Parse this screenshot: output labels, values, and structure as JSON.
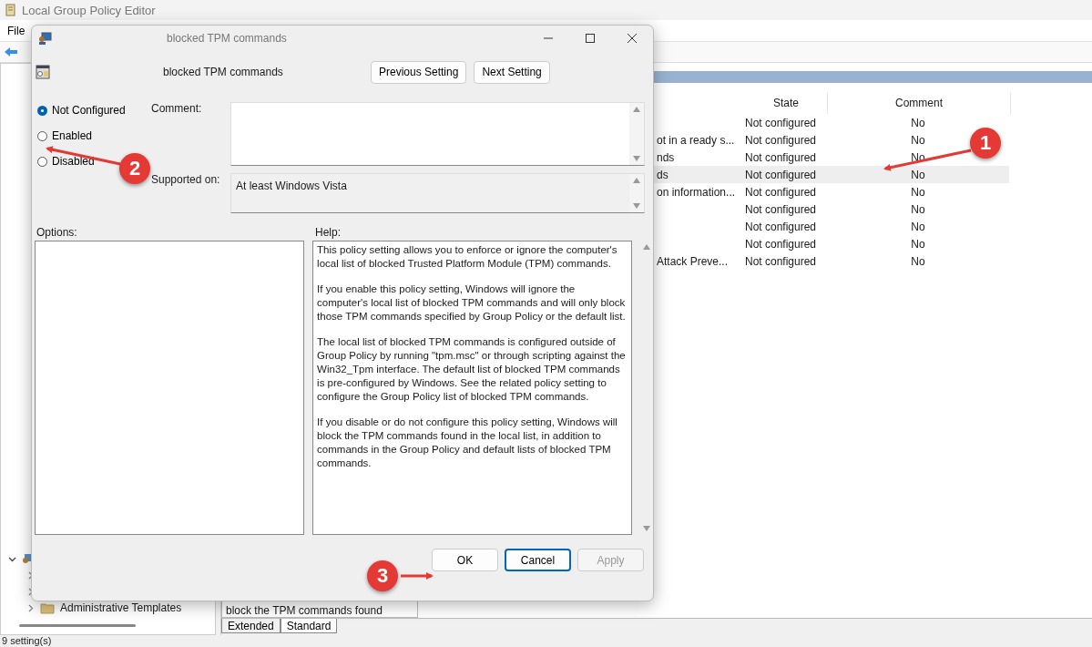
{
  "window": {
    "title": "Local Group Policy Editor",
    "menu": [
      "File"
    ]
  },
  "tree": {
    "items": [
      {
        "expanded": true
      },
      {
        "expanded": false
      },
      {
        "expanded": false
      },
      {
        "label": "Administrative Templates",
        "expanded": false
      }
    ]
  },
  "table": {
    "columns": [
      "State",
      "Comment"
    ],
    "rows": [
      {
        "state": "Not configured",
        "comment": "No",
        "selected": false
      },
      {
        "name": "ot in a ready s...",
        "state": "Not configured",
        "comment": "No",
        "selected": false
      },
      {
        "name": "nds",
        "state": "Not configured",
        "comment": "No",
        "selected": false
      },
      {
        "name": "ds",
        "state": "Not configured",
        "comment": "No",
        "selected": true
      },
      {
        "name": "on information...",
        "state": "Not configured",
        "comment": "No",
        "selected": false
      },
      {
        "state": "Not configured",
        "comment": "No",
        "selected": false
      },
      {
        "state": "Not configured",
        "comment": "No",
        "selected": false
      },
      {
        "state": "Not configured",
        "comment": "No",
        "selected": false
      },
      {
        "name": "Attack Preve...",
        "state": "Not configured",
        "comment": "No",
        "selected": false
      }
    ]
  },
  "description_pane": {
    "text": "block the TPM commands found"
  },
  "view_tabs": [
    {
      "label": "Extended",
      "selected": false
    },
    {
      "label": "Standard",
      "selected": true
    }
  ],
  "status_bar": "9 setting(s)",
  "dialog": {
    "title": "blocked TPM commands",
    "heading": "blocked TPM commands",
    "nav_buttons": [
      "Previous Setting",
      "Next Setting"
    ],
    "options": [
      {
        "label": "Not Configured",
        "selected": true
      },
      {
        "label": "Enabled",
        "selected": false
      },
      {
        "label": "Disabled",
        "selected": false
      }
    ],
    "comment_label": "Comment:",
    "supported_label": "Supported on:",
    "supported_value": "At least Windows Vista",
    "options_label": "Options:",
    "help_label": "Help:",
    "help": [
      "This policy setting allows you to enforce or ignore the computer's local list of blocked Trusted Platform Module (TPM) commands.",
      "If you enable this policy setting, Windows will ignore the computer's local list of blocked TPM commands and will only block those TPM commands specified by Group Policy or the default list.",
      "The local list of blocked TPM commands is configured outside of Group Policy by running \"tpm.msc\" or through scripting against the Win32_Tpm interface. The default list of blocked TPM commands is pre-configured by Windows. See the related policy setting to configure the Group Policy list of blocked TPM commands.",
      "If you disable or do not configure this policy setting, Windows will block the TPM commands found in the local list, in addition to commands in the Group Policy and default lists of blocked TPM commands."
    ],
    "buttons": [
      {
        "label": "OK",
        "disabled": false,
        "default": false
      },
      {
        "label": "Cancel",
        "disabled": false,
        "default": true
      },
      {
        "label": "Apply",
        "disabled": true,
        "default": false
      }
    ]
  },
  "annotations": [
    "1",
    "2",
    "3"
  ]
}
